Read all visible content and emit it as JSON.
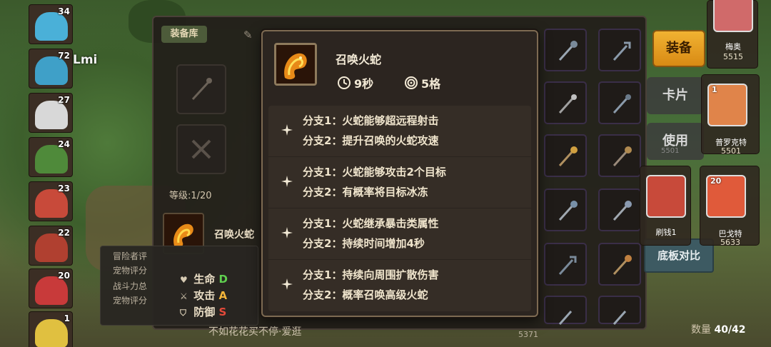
{
  "left_heroes": {
    "levels": [
      "34",
      "72",
      "27",
      "24",
      "23",
      "22",
      "20",
      "1"
    ],
    "player_name": "Lmi"
  },
  "panel": {
    "tab_label": "装备库",
    "level_label": "等级:1/20",
    "skill_name": "召唤火蛇",
    "stats_lines": [
      "冒险者评",
      "宠物评分",
      "战斗力总",
      "宠物评分"
    ],
    "stats": [
      {
        "icon": "heart-icon",
        "label": "生命",
        "grade": "D"
      },
      {
        "icon": "sword-icon",
        "label": "攻击",
        "grade": "A"
      },
      {
        "icon": "shield-icon",
        "label": "防御",
        "grade": "S"
      }
    ],
    "hint": "不如花花买不停·爱逛",
    "count_label": "数量",
    "count_value": "40/42",
    "weapon_power": "5371"
  },
  "right_side": {
    "equip_button": "装备",
    "card_button": "卡片",
    "use_button": "使用",
    "compare_button": "底板对比",
    "use_sub": "5501",
    "characters": [
      {
        "name": "梅奥",
        "power": "5515"
      },
      {
        "name": "普罗克特",
        "power": "5501",
        "level": "1"
      },
      {
        "name": "刷钱1",
        "power": ""
      },
      {
        "name": "巴戈特",
        "power": "5633",
        "level": "20"
      }
    ]
  },
  "tooltip": {
    "title": "召唤火蛇",
    "cooldown": "9秒",
    "range": "5格",
    "branch_groups": [
      {
        "branch1": "分支1：火蛇能够超远程射击",
        "branch2": "分支2：提升召唤的火蛇攻速"
      },
      {
        "branch1": "分支1：火蛇能够攻击2个目标",
        "branch2": "分支2：有概率将目标冰冻"
      },
      {
        "branch1": "分支1：火蛇继承暴击类属性",
        "branch2": "分支2：持续时间增加4秒"
      },
      {
        "branch1": "分支1：持续向周围扩散伤害",
        "branch2": "分支2：概率召唤高级火蛇"
      }
    ]
  },
  "colors": {
    "grade_d": "#5fcf4f",
    "grade_a": "#f3b53a",
    "grade_s": "#e64a3a",
    "equip_button": "#f1b232"
  }
}
